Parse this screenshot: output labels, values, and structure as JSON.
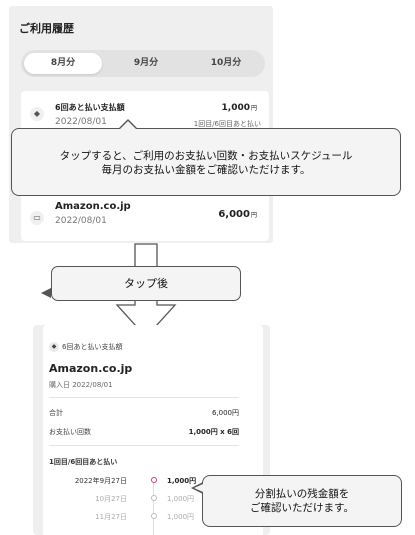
{
  "history": {
    "title": "ご利用履歴",
    "tabs": [
      {
        "label": "8月分",
        "active": true
      },
      {
        "label": "9月分",
        "active": false
      },
      {
        "label": "10月分",
        "active": false
      }
    ],
    "items": [
      {
        "icon": "installment-icon",
        "name": "6回あと払い支払額",
        "date": "2022/08/01",
        "amount": "1,000",
        "yen": "円",
        "sub": "1回目/6回目あと払い"
      },
      {
        "icon": "cart-icon",
        "name": "Amazon.co.jp",
        "date": "2022/08/01",
        "amount": "6,000",
        "yen": "円"
      }
    ]
  },
  "callout_top": {
    "line1": "タップすると、ご利用のお支払い回数・お支払いスケジュール",
    "line2": "毎月のお支払い金額をご確認いただけます。"
  },
  "after_label": "タップ後",
  "detail": {
    "badge": "6回あと払い支払額",
    "shop": "Amazon.co.jp",
    "purchase_date": "購入日 2022/08/01",
    "total_label": "合計",
    "total_value": "6,000円",
    "count_label": "お支払い回数",
    "count_value": "1,000円 x 6回",
    "installment_label": "1回目/6回目あと払い",
    "schedule": [
      {
        "date": "2022年9月27日",
        "amount": "1,000円",
        "state": "current"
      },
      {
        "date": "10月27日",
        "amount": "1,000円",
        "state": "future"
      },
      {
        "date": "11月27日",
        "amount": "1,000円",
        "state": "future"
      }
    ]
  },
  "callout_bottom": {
    "line1": "分割払いの残金額を",
    "line2": "ご確認いただけます。"
  },
  "colors": {
    "accent": "#d23b79",
    "panel": "#efefef",
    "callout_bg": "#f4f4f4"
  }
}
